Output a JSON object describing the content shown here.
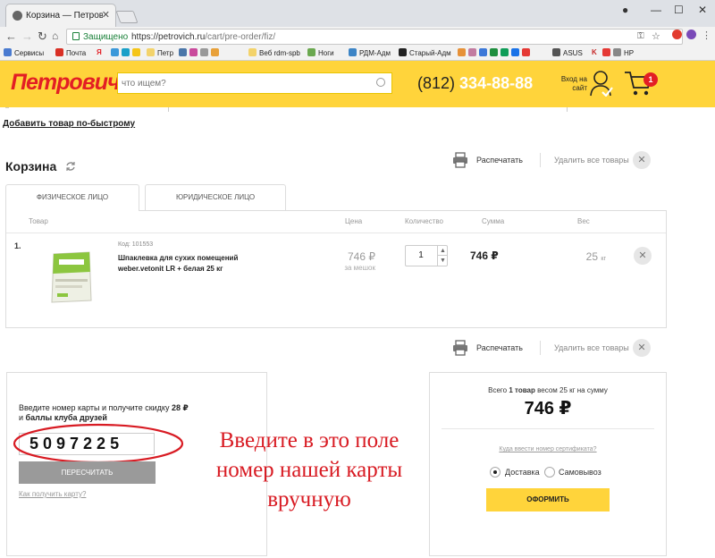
{
  "browser": {
    "tab_title": "Корзина — Петрович в",
    "secure_label": "Защищено",
    "url_host": "https://petrovich.ru",
    "url_path": "/cart/pre-order/fiz/",
    "bookmarks": [
      "Сервисы",
      "Почта",
      "Я",
      "Петр",
      "Веб rdm-spb",
      "Ноги",
      "РДМ-Адм",
      "Старый-Адм",
      "ASUS",
      "K",
      "HP"
    ]
  },
  "header": {
    "logo": "Петрович",
    "search_placeholder": "что ищем?",
    "phone_code": "(812)",
    "phone_number": "334-88-88",
    "login_label": "Вход на сайт",
    "cart_count": "1"
  },
  "page": {
    "quick_add": "Добавить товар по-быстрому",
    "title": "Корзина",
    "print_label": "Распечатать",
    "remove_all_label": "Удалить все товары"
  },
  "tabs": [
    "ФИЗИЧЕСКОЕ ЛИЦО",
    "ЮРИДИЧЕСКОЕ ЛИЦО"
  ],
  "table": {
    "headers": [
      "Товар",
      "Цена",
      "Количество",
      "Сумма",
      "Вес"
    ],
    "rows": [
      {
        "num": "1.",
        "code": "Код: 101553",
        "name": "Шпаклевка для сухих помещений weber.vetonit LR + белая 25 кг",
        "price": "746 ₽",
        "price_unit": "за мешок",
        "qty": "1",
        "sum": "746 ₽",
        "weight": "25",
        "weight_unit": "кг"
      }
    ]
  },
  "discount": {
    "prompt_line1": "Введите номер карты и получите скидку",
    "prompt_bold1": "28 ₽",
    "prompt_and": "и",
    "prompt_bold2": "баллы клуба друзей",
    "card_number": "5097225",
    "recalc_label": "ПЕРЕСЧИТАТЬ",
    "how_link": "Как получить карту?"
  },
  "annotation": {
    "text": "Введите в это поле номер нашей карты вручную",
    "color": "#d81b23"
  },
  "summary": {
    "line_prefix": "Всего",
    "line_bold": "1 товар",
    "line_suffix": "весом 25 кг на сумму",
    "total": "746 ₽",
    "cert_link": "Куда ввести номер сертификата?",
    "delivery_options": [
      "Доставка",
      "Самовывоз"
    ],
    "selected_delivery": "Доставка",
    "checkout_label": "ОФОРМИТЬ"
  },
  "colors": {
    "brand_yellow": "#ffd43b",
    "brand_red": "#e31e24"
  }
}
